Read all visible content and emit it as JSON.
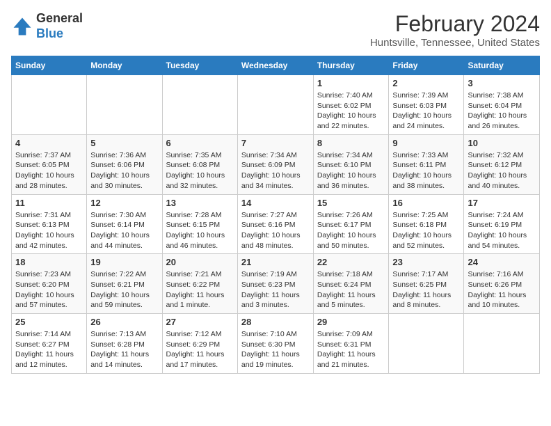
{
  "header": {
    "logo_line1": "General",
    "logo_line2": "Blue",
    "title": "February 2024",
    "subtitle": "Huntsville, Tennessee, United States"
  },
  "calendar": {
    "days_of_week": [
      "Sunday",
      "Monday",
      "Tuesday",
      "Wednesday",
      "Thursday",
      "Friday",
      "Saturday"
    ],
    "weeks": [
      [
        {
          "day": "",
          "info": ""
        },
        {
          "day": "",
          "info": ""
        },
        {
          "day": "",
          "info": ""
        },
        {
          "day": "",
          "info": ""
        },
        {
          "day": "1",
          "info": "Sunrise: 7:40 AM\nSunset: 6:02 PM\nDaylight: 10 hours\nand 22 minutes."
        },
        {
          "day": "2",
          "info": "Sunrise: 7:39 AM\nSunset: 6:03 PM\nDaylight: 10 hours\nand 24 minutes."
        },
        {
          "day": "3",
          "info": "Sunrise: 7:38 AM\nSunset: 6:04 PM\nDaylight: 10 hours\nand 26 minutes."
        }
      ],
      [
        {
          "day": "4",
          "info": "Sunrise: 7:37 AM\nSunset: 6:05 PM\nDaylight: 10 hours\nand 28 minutes."
        },
        {
          "day": "5",
          "info": "Sunrise: 7:36 AM\nSunset: 6:06 PM\nDaylight: 10 hours\nand 30 minutes."
        },
        {
          "day": "6",
          "info": "Sunrise: 7:35 AM\nSunset: 6:08 PM\nDaylight: 10 hours\nand 32 minutes."
        },
        {
          "day": "7",
          "info": "Sunrise: 7:34 AM\nSunset: 6:09 PM\nDaylight: 10 hours\nand 34 minutes."
        },
        {
          "day": "8",
          "info": "Sunrise: 7:34 AM\nSunset: 6:10 PM\nDaylight: 10 hours\nand 36 minutes."
        },
        {
          "day": "9",
          "info": "Sunrise: 7:33 AM\nSunset: 6:11 PM\nDaylight: 10 hours\nand 38 minutes."
        },
        {
          "day": "10",
          "info": "Sunrise: 7:32 AM\nSunset: 6:12 PM\nDaylight: 10 hours\nand 40 minutes."
        }
      ],
      [
        {
          "day": "11",
          "info": "Sunrise: 7:31 AM\nSunset: 6:13 PM\nDaylight: 10 hours\nand 42 minutes."
        },
        {
          "day": "12",
          "info": "Sunrise: 7:30 AM\nSunset: 6:14 PM\nDaylight: 10 hours\nand 44 minutes."
        },
        {
          "day": "13",
          "info": "Sunrise: 7:28 AM\nSunset: 6:15 PM\nDaylight: 10 hours\nand 46 minutes."
        },
        {
          "day": "14",
          "info": "Sunrise: 7:27 AM\nSunset: 6:16 PM\nDaylight: 10 hours\nand 48 minutes."
        },
        {
          "day": "15",
          "info": "Sunrise: 7:26 AM\nSunset: 6:17 PM\nDaylight: 10 hours\nand 50 minutes."
        },
        {
          "day": "16",
          "info": "Sunrise: 7:25 AM\nSunset: 6:18 PM\nDaylight: 10 hours\nand 52 minutes."
        },
        {
          "day": "17",
          "info": "Sunrise: 7:24 AM\nSunset: 6:19 PM\nDaylight: 10 hours\nand 54 minutes."
        }
      ],
      [
        {
          "day": "18",
          "info": "Sunrise: 7:23 AM\nSunset: 6:20 PM\nDaylight: 10 hours\nand 57 minutes."
        },
        {
          "day": "19",
          "info": "Sunrise: 7:22 AM\nSunset: 6:21 PM\nDaylight: 10 hours\nand 59 minutes."
        },
        {
          "day": "20",
          "info": "Sunrise: 7:21 AM\nSunset: 6:22 PM\nDaylight: 11 hours\nand 1 minute."
        },
        {
          "day": "21",
          "info": "Sunrise: 7:19 AM\nSunset: 6:23 PM\nDaylight: 11 hours\nand 3 minutes."
        },
        {
          "day": "22",
          "info": "Sunrise: 7:18 AM\nSunset: 6:24 PM\nDaylight: 11 hours\nand 5 minutes."
        },
        {
          "day": "23",
          "info": "Sunrise: 7:17 AM\nSunset: 6:25 PM\nDaylight: 11 hours\nand 8 minutes."
        },
        {
          "day": "24",
          "info": "Sunrise: 7:16 AM\nSunset: 6:26 PM\nDaylight: 11 hours\nand 10 minutes."
        }
      ],
      [
        {
          "day": "25",
          "info": "Sunrise: 7:14 AM\nSunset: 6:27 PM\nDaylight: 11 hours\nand 12 minutes."
        },
        {
          "day": "26",
          "info": "Sunrise: 7:13 AM\nSunset: 6:28 PM\nDaylight: 11 hours\nand 14 minutes."
        },
        {
          "day": "27",
          "info": "Sunrise: 7:12 AM\nSunset: 6:29 PM\nDaylight: 11 hours\nand 17 minutes."
        },
        {
          "day": "28",
          "info": "Sunrise: 7:10 AM\nSunset: 6:30 PM\nDaylight: 11 hours\nand 19 minutes."
        },
        {
          "day": "29",
          "info": "Sunrise: 7:09 AM\nSunset: 6:31 PM\nDaylight: 11 hours\nand 21 minutes."
        },
        {
          "day": "",
          "info": ""
        },
        {
          "day": "",
          "info": ""
        }
      ]
    ]
  }
}
